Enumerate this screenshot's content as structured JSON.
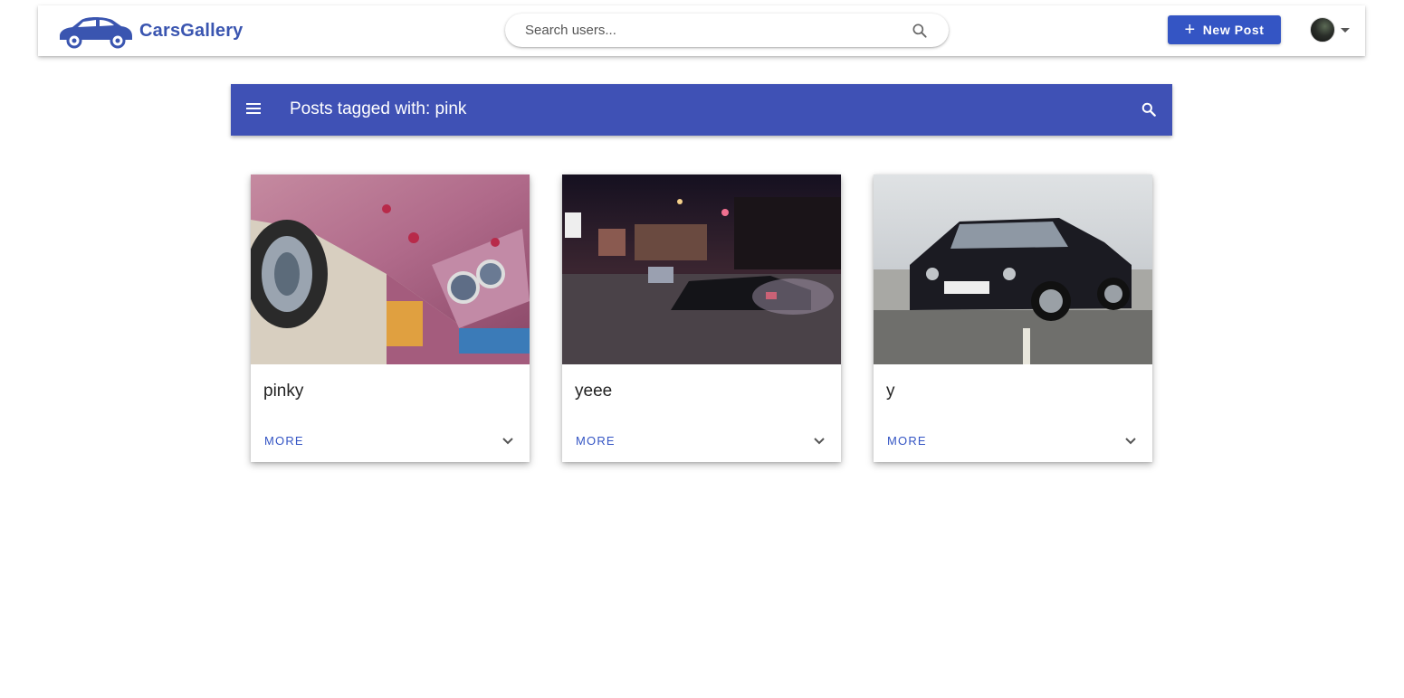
{
  "navbar": {
    "brand_name": "CarsGallery",
    "brand_logo_icon": "car-logo-icon",
    "search_placeholder": "Search users...",
    "search_icon": "search-icon",
    "new_post_label": "New Post",
    "new_post_icon": "plus-icon",
    "avatar_icon": "avatar",
    "avatar_dropdown_icon": "caret-down-icon"
  },
  "toolbar": {
    "title": "Posts tagged with: pink",
    "menu_icon": "menu-icon",
    "search_icon": "search-icon",
    "background_color": "#3f51b5"
  },
  "posts": [
    {
      "title": "pinky",
      "more_label": "MORE",
      "image_subject": "pink car close-up"
    },
    {
      "title": "yeee",
      "more_label": "MORE",
      "image_subject": "drifting car at night"
    },
    {
      "title": "y",
      "more_label": "MORE",
      "image_subject": "black BMW E30"
    }
  ],
  "colors": {
    "brand": "#3a55b0",
    "primary_button": "#3455c4",
    "link": "#3455c4"
  }
}
